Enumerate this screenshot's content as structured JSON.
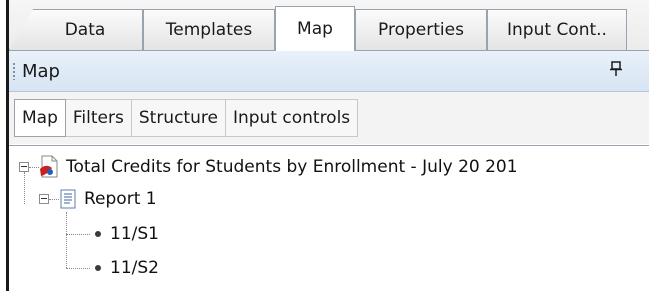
{
  "tabs": [
    {
      "label": "Data"
    },
    {
      "label": "Templates"
    },
    {
      "label": "Map",
      "active": true
    },
    {
      "label": "Properties"
    },
    {
      "label": "Input Cont.."
    }
  ],
  "panel": {
    "title": "Map",
    "pin_icon": "pin-icon"
  },
  "subtabs": [
    {
      "label": "Map",
      "active": true
    },
    {
      "label": "Filters"
    },
    {
      "label": "Structure"
    },
    {
      "label": "Input controls"
    }
  ],
  "tree": {
    "document": {
      "label": "Total Credits for Students by Enrollment - July 20 201",
      "icon": "document-icon"
    },
    "report": {
      "label": "Report 1",
      "icon": "report-icon"
    },
    "sections": [
      {
        "label": "11/S1"
      },
      {
        "label": "11/S2"
      }
    ]
  },
  "colors": {
    "header_blue": "#d7e4f3",
    "tab_border": "#9aa3ad",
    "document_icon_red": "#cc1f1f"
  }
}
